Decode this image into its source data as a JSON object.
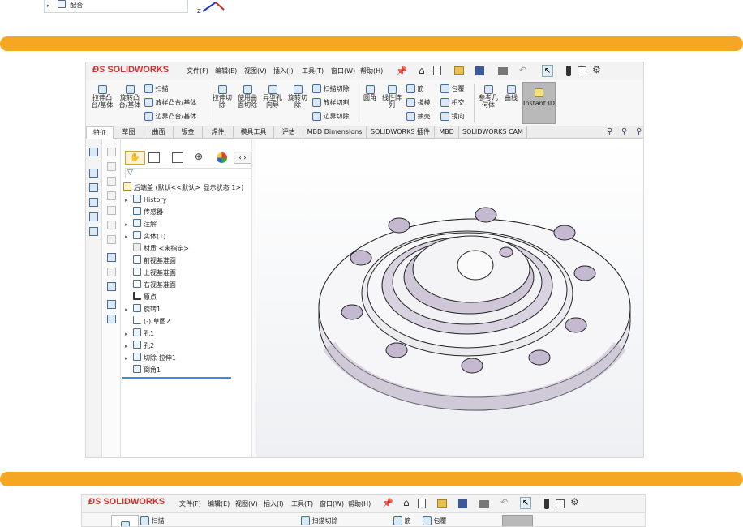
{
  "top_crop": {
    "item_label": "配合",
    "axis_label": "Z"
  },
  "window": {
    "logo": "SOLIDWORKS",
    "menu": [
      "文件(F)",
      "编辑(E)",
      "视图(V)",
      "插入(I)",
      "工具(T)",
      "窗口(W)",
      "帮助(H)"
    ],
    "ribbon": {
      "extrude_boss": "拉伸凸\n台/基体",
      "revolve_boss": "旋转凸\n台/基体",
      "sweep": "扫描",
      "loft": "放样凸台/基体",
      "boundary": "边界凸台/基体",
      "extrude_cut": "拉伸切\n除",
      "hole_cut": "使用曲\n面切除",
      "hole_wizard": "异型孔\n向导",
      "revolve_cut": "旋转切\n除",
      "swept_cut": "扫描切除",
      "lofted_cut": "放样切割",
      "boundary_cut": "边界切除",
      "fillet": "圆角",
      "linear_pattern": "线性阵\n列",
      "rib": "筋",
      "draft": "拔模",
      "shell": "抽壳",
      "wrap": "包覆",
      "intersect": "相交",
      "mirror": "镜向",
      "ref_geometry": "参考几\n何体",
      "curves": "曲线",
      "instant3d": "Instant3D"
    },
    "tabs": [
      "特征",
      "草图",
      "曲面",
      "钣金",
      "焊件",
      "模具工具",
      "评估",
      "MBD Dimensions",
      "SOLIDWORKS 插件",
      "MBD",
      "SOLIDWORKS CAM"
    ],
    "tree": {
      "root": "后端盖 (默认<<默认>_显示状态 1>)",
      "items": [
        "History",
        "传感器",
        "注解",
        "实体(1)",
        "材质 <未指定>",
        "前视基准面",
        "上视基准面",
        "右视基准面",
        "原点",
        "旋转1",
        "(-) 草图2",
        "孔1",
        "孔2",
        "切除-拉伸1",
        "倒角1"
      ]
    }
  },
  "bottom_crop": {
    "logo": "SOLIDWORKS",
    "menu": [
      "文件(F)",
      "编辑(E)",
      "视图(V)",
      "插入(I)",
      "工具(T)",
      "窗口(W)",
      "帮助(H)"
    ],
    "sweep": "扫描",
    "swept_cut": "扫描切除",
    "rib": "筋",
    "wrap": "包覆"
  },
  "colors": {
    "accent_bar": "#f5a623",
    "selection_blue": "#3a8fd8",
    "brand_red": "#d0312d"
  }
}
